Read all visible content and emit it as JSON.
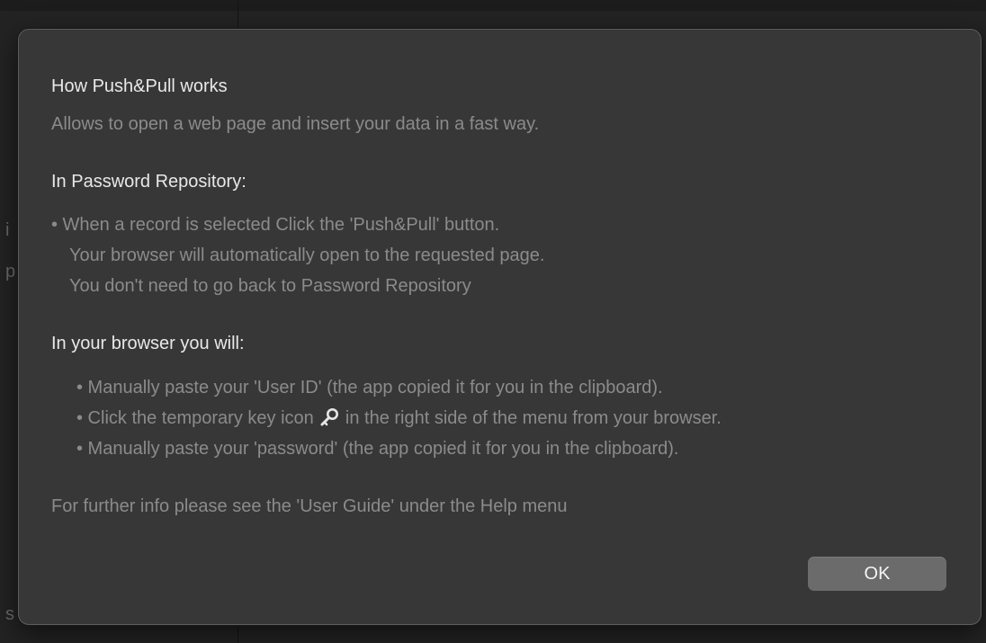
{
  "dialog": {
    "title": "How Push&Pull works",
    "intro": "Allows to open a web page and insert your data in a fast way.",
    "repository_heading": "In Password Repository:",
    "repository_lines": [
      "• When a record is selected Click the 'Push&Pull' button.",
      "Your browser will automatically open to the requested page.",
      "You don't need to go back to Password Repository"
    ],
    "browser_heading": "In your browser you will:",
    "browser_line_1": "• Manually paste your 'User ID' (the app copied it for you in the clipboard).",
    "browser_line_2_before_icon": "• Click the temporary key icon",
    "browser_line_2_after_icon": " in the right side of the menu from your browser.",
    "browser_line_3": "• Manually paste your 'password' (the app copied it for you in the clipboard).",
    "footer": "For further info please see the 'User Guide' under the Help menu",
    "ok_label": "OK",
    "key_icon": "key-icon"
  },
  "background": {
    "edge_letters": [
      "i",
      "p",
      "s"
    ]
  },
  "colors": {
    "sheet_background": "#373737",
    "heading_text": "#e8e8e8",
    "muted_text": "#8b8b8b",
    "button_background": "#6b6b6b"
  }
}
